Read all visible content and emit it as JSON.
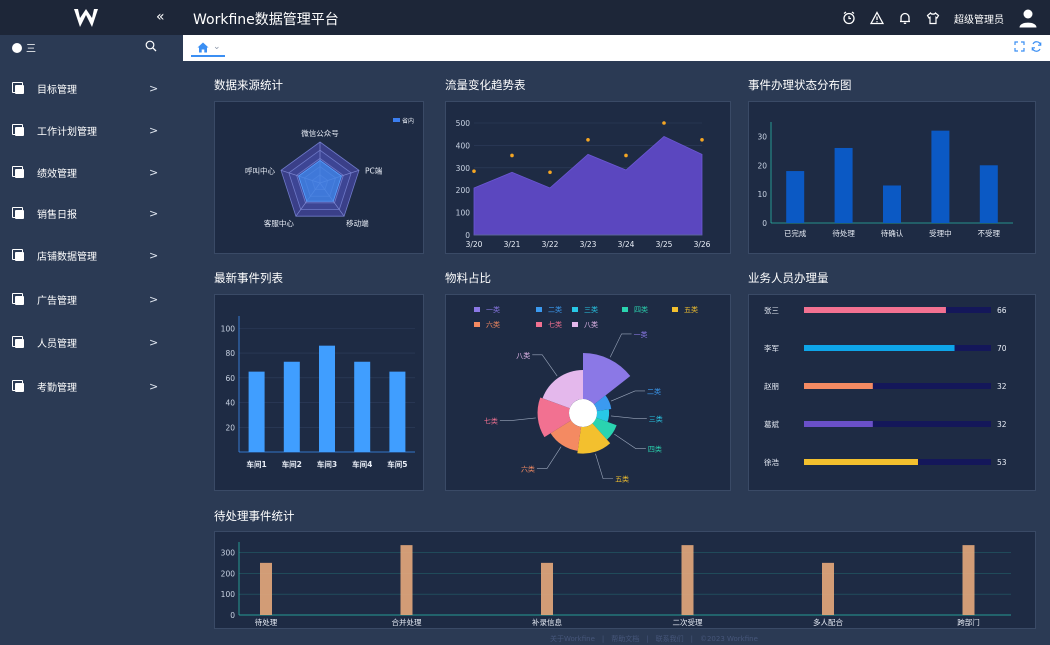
{
  "app": {
    "title": "Workfine数据管理平台",
    "user": "超级管理员"
  },
  "sidebar": {
    "head": "三",
    "items": [
      {
        "label": "目标管理"
      },
      {
        "label": "工作计划管理"
      },
      {
        "label": "绩效管理"
      },
      {
        "label": "销售日报"
      },
      {
        "label": "店铺数据管理"
      },
      {
        "label": "广告管理"
      },
      {
        "label": "人员管理"
      },
      {
        "label": "考勤管理"
      }
    ]
  },
  "tabs": {
    "dropdown": "⌄"
  },
  "sections": {
    "source": "数据来源统计",
    "traffic": "流量变化趋势表",
    "status": "事件办理状态分布图",
    "events": "最新事件列表",
    "material": "物料占比",
    "staff": "业务人员办理量",
    "pending": "待处理事件统计"
  },
  "colors": {
    "topbar": "#1d2638",
    "panel": "#1e2b44",
    "accent": "#3b8ff3"
  },
  "chart_data": [
    {
      "type": "radar",
      "legend": [
        "省内"
      ],
      "indicators": [
        "微信公众号",
        "PC端",
        "移动端",
        "客服中心",
        "呼叫中心"
      ]
    },
    {
      "type": "area",
      "categories": [
        "3/20",
        "3/21",
        "3/22",
        "3/23",
        "3/24",
        "3/25",
        "3/26"
      ],
      "series": [
        {
          "type": "area",
          "values": [
            210,
            280,
            210,
            360,
            290,
            440,
            360
          ]
        },
        {
          "type": "scatter",
          "values": [
            285,
            355,
            280,
            425,
            355,
            500,
            425
          ]
        }
      ],
      "ylim": [
        0,
        500
      ],
      "yticks": [
        0,
        100,
        200,
        300,
        400,
        500
      ]
    },
    {
      "type": "bar",
      "categories": [
        "已完成",
        "待处理",
        "待确认",
        "受理中",
        "不受理"
      ],
      "values": [
        18,
        26,
        13,
        32,
        20
      ],
      "ylim": [
        0,
        35
      ],
      "yticks": [
        0,
        10,
        20,
        30
      ]
    },
    {
      "type": "bar",
      "categories": [
        "车间1",
        "车间2",
        "车间3",
        "车间4",
        "车间5"
      ],
      "values": [
        65,
        73,
        86,
        73,
        65
      ],
      "ylim": [
        0,
        110
      ],
      "yticks": [
        20,
        40,
        60,
        80,
        100
      ]
    },
    {
      "type": "pie",
      "legend": [
        "一类",
        "二类",
        "三类",
        "四类",
        "五类",
        "六类",
        "七类",
        "八类"
      ],
      "labels": [
        "一类",
        "二类",
        "三类",
        "四类",
        "五类",
        "六类",
        "七类",
        "八类"
      ],
      "values": [
        38,
        12,
        10,
        18,
        22,
        20,
        26,
        24
      ],
      "colors": [
        "#8b78e6",
        "#3b9af0",
        "#28c8e6",
        "#2ad4b0",
        "#f3c02e",
        "#f48a62",
        "#f27191",
        "#e4b8ec"
      ]
    },
    {
      "type": "bar",
      "orientation": "horizontal",
      "categories": [
        "张三",
        "李军",
        "赵朋",
        "葛斌",
        "徐浩"
      ],
      "values": [
        66,
        70,
        32,
        32,
        53
      ],
      "xlim": [
        0,
        100
      ],
      "colors": [
        "#f27191",
        "#0ea5e9",
        "#f48a62",
        "#6a50c8",
        "#f3c02e"
      ]
    },
    {
      "type": "bar",
      "categories": [
        "待处理",
        "合并处理",
        "补录信息",
        "二次受理",
        "多人配合",
        "跨部门"
      ],
      "values": [
        250,
        335,
        250,
        335,
        250,
        335
      ],
      "ylim": [
        0,
        350
      ],
      "yticks": [
        0,
        100,
        200,
        300
      ]
    }
  ],
  "footer": "关于Workfine　|　帮助文档　|　联系我们　|　©2023 Workfine"
}
